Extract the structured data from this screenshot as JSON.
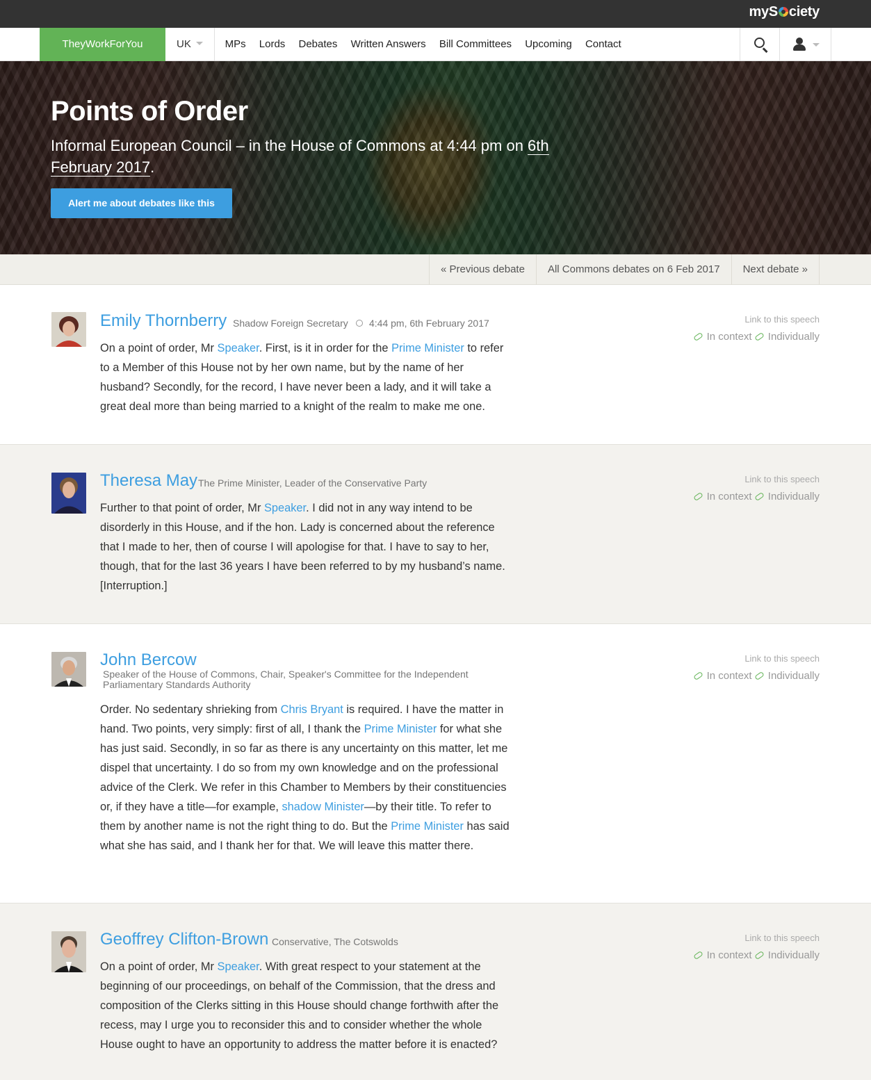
{
  "topbar": {
    "brand": "mySociety",
    "brand_pre": "myS",
    "brand_post": "ciety"
  },
  "nav": {
    "brand": "TheyWorkForYou",
    "country": "UK",
    "items": [
      "MPs",
      "Lords",
      "Debates",
      "Written Answers",
      "Bill Committees",
      "Upcoming",
      "Contact"
    ]
  },
  "hero": {
    "title": "Points of Order",
    "subtitle_pre": "Informal European Council – in the House of Commons at 4:44 pm on ",
    "date_part1": "6th",
    "date_part2": "February 2017",
    "subtitle_post": ".",
    "alert_button": "Alert me about debates like this"
  },
  "pager": {
    "prev": "« Previous debate",
    "all": "All Commons debates on 6 Feb 2017",
    "next": "Next debate »"
  },
  "links": {
    "label": "Link to this speech",
    "context": "In context",
    "individually": "Individually"
  },
  "speeches": [
    {
      "name": "Emily Thornberry",
      "role": "Shadow Foreign Secretary",
      "time": "4:44 pm, 6th February 2017",
      "text": [
        {
          "t": "On a point of order, Mr "
        },
        {
          "l": "Speaker"
        },
        {
          "t": ". First, is it in order for the "
        },
        {
          "l": "Prime Minister"
        },
        {
          "t": " to refer to a Member of this House not by her own name, but by the name of her husband? Secondly, for the record, I have never been a lady, and it will take a great deal more than being married to a knight of the realm to make me one."
        }
      ]
    },
    {
      "name": "Theresa May",
      "role": "The Prime Minister, Leader of the Conservative Party",
      "text": [
        {
          "t": "Further to that point of order, Mr "
        },
        {
          "l": "Speaker"
        },
        {
          "t": ". I did not in any way intend to be disorderly in this House, and if the hon. Lady is concerned about the reference that I made to her, then of course I will apologise for that. I have to say to her, though, that for the last 36 years I have been referred to by my husband’s name. [Interruption.]"
        }
      ]
    },
    {
      "name": "John Bercow",
      "role": "Speaker of the House of Commons, Chair, Speaker's Committee for the Independent Parliamentary Standards Authority",
      "text": [
        {
          "t": "Order. No sedentary shrieking from "
        },
        {
          "l": "Chris Bryant"
        },
        {
          "t": " is required. I have the matter in hand. Two points, very simply: first of all, I thank the "
        },
        {
          "l": "Prime Minister"
        },
        {
          "t": " for what she has just said. Secondly, in so far as there is any uncertainty on this matter, let me dispel that uncertainty. I do so from my own knowledge and on the professional advice of the Clerk. We refer in this Chamber to Members by their constituencies or, if they have a title—for example, "
        },
        {
          "l": "shadow Minister"
        },
        {
          "t": "—by their title. To refer to them by another name is not the right thing to do. But the "
        },
        {
          "l": "Prime Minister"
        },
        {
          "t": " has said what she has said, and I thank her for that. We will leave this matter there."
        }
      ]
    },
    {
      "name": "Geoffrey Clifton-Brown",
      "role": "Conservative, The Cotswolds",
      "text": [
        {
          "t": "On a point of order, Mr "
        },
        {
          "l": "Speaker"
        },
        {
          "t": ". With great respect to your statement at the beginning of our proceedings, on behalf of the Commission, that the dress and composition of the Clerks sitting in this House should change forthwith after the recess, may I urge you to reconsider this and to consider whether the whole House ought to have an opportunity to address the matter before it is enacted?"
        }
      ]
    }
  ],
  "colors": {
    "brand_green": "#62b356",
    "link_blue": "#3d9ee0",
    "topbar": "#333333",
    "alt_row": "#f3f2ee"
  }
}
